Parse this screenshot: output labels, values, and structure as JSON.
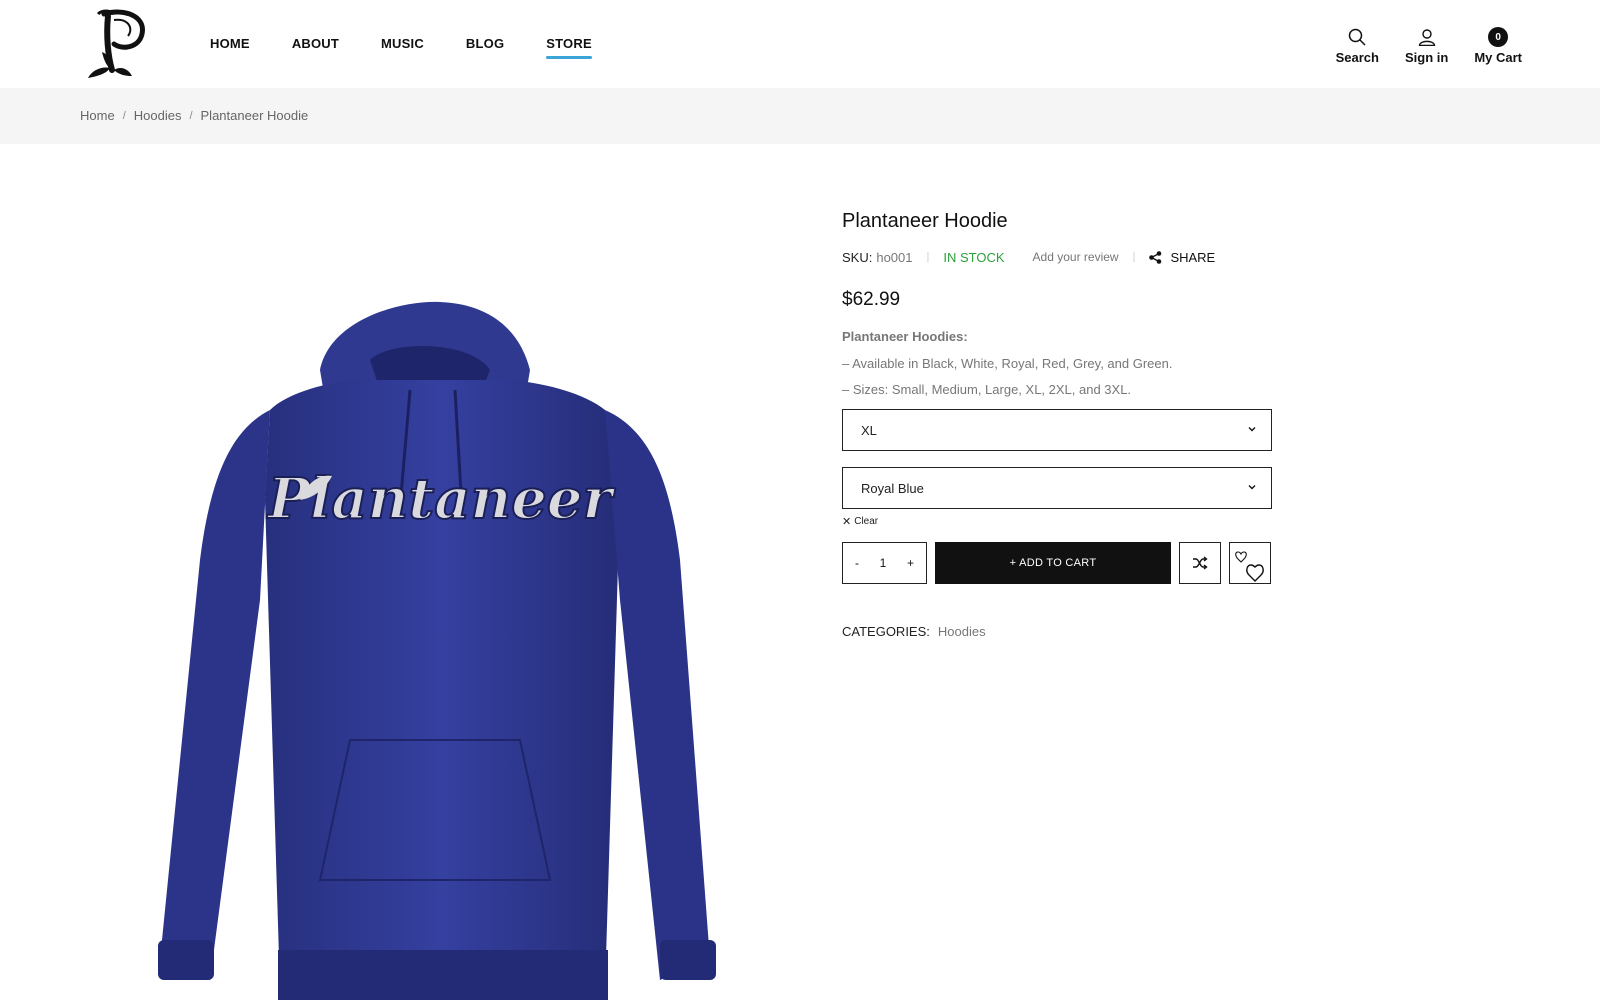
{
  "header": {
    "nav": [
      {
        "label": "HOME"
      },
      {
        "label": "ABOUT"
      },
      {
        "label": "MUSIC"
      },
      {
        "label": "BLOG"
      },
      {
        "label": "STORE",
        "active": true
      }
    ],
    "tools": {
      "search_label": "Search",
      "signin_label": "Sign in",
      "cart_label": "My Cart",
      "cart_count": "0"
    }
  },
  "breadcrumb": {
    "items": [
      "Home",
      "Hoodies"
    ],
    "current": "Plantaneer Hoodie"
  },
  "product": {
    "title": "Plantaneer Hoodie",
    "sku_label": "SKU:",
    "sku_value": "ho001",
    "stock": "IN STOCK",
    "review_link": "Add your review",
    "share_label": "SHARE",
    "price": "$62.99",
    "description_title": "Plantaneer Hoodies:",
    "description_lines": [
      "– Available in Black, White, Royal, Red, Grey, and Green.",
      "– Sizes: Small, Medium, Large, XL, 2XL, and 3XL."
    ],
    "size_selected": "XL",
    "color_selected": "Royal Blue",
    "clear_label": "Clear",
    "quantity": "1",
    "qty_minus": "-",
    "qty_plus": "+",
    "add_to_cart": "+ ADD TO CART",
    "categories_label": "CATEGORIES:",
    "category": "Hoodies",
    "image_text": "Plantaneer"
  },
  "colors": {
    "accent": "#3ba4d8",
    "in_stock": "#2aa23a",
    "hoodie": "#2e3a95"
  }
}
